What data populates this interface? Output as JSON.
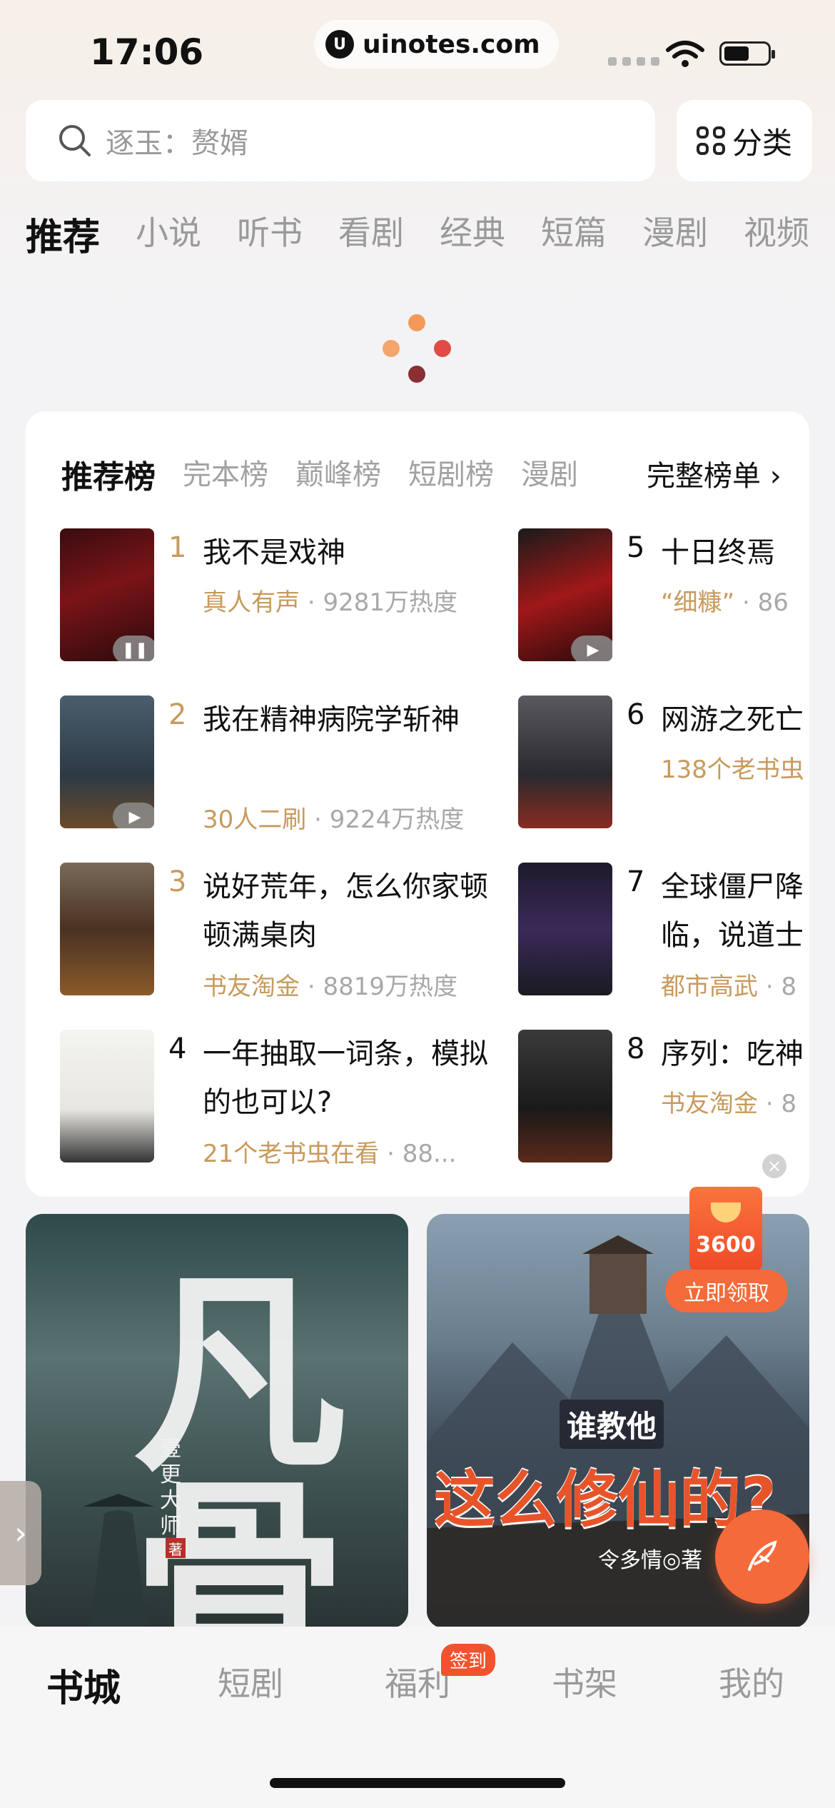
{
  "status_bar": {
    "time": "17:06",
    "url": "uinotes.com"
  },
  "search": {
    "placeholder": "逐玉：赘婿",
    "category_label": "分类"
  },
  "channel_tabs": [
    "推荐",
    "小说",
    "听书",
    "看剧",
    "经典",
    "短篇",
    "漫剧",
    "视频"
  ],
  "ranking": {
    "tabs": [
      "推荐榜",
      "完本榜",
      "巅峰榜",
      "短剧榜",
      "漫剧"
    ],
    "full_list": "完整榜单 ›",
    "left_books": [
      {
        "rank": "1",
        "title": "我不是戏神",
        "tag": "真人有声",
        "heat": "9281万热度"
      },
      {
        "rank": "2",
        "title": "我在精神病院学斩神",
        "tag": "30人二刷",
        "heat": "9224万热度"
      },
      {
        "rank": "3",
        "title": "说好荒年，怎么你家顿顿满桌肉",
        "tag": "书友淘金",
        "heat": "8819万热度"
      },
      {
        "rank": "4",
        "title": "一年抽取一词条，模拟的也可以?",
        "tag": "21个老书虫在看",
        "heat": "88..."
      }
    ],
    "right_books": [
      {
        "rank": "5",
        "title": "十日终焉",
        "tag": "“细糠”",
        "heat": "86"
      },
      {
        "rank": "6",
        "title": "网游之死亡",
        "tag": "138个老书虫",
        "heat": ""
      },
      {
        "rank": "7",
        "title": "全球僵尸降临，说道士序列",
        "tag": "都市高武",
        "heat": "8"
      },
      {
        "rank": "8",
        "title": "序列：吃神",
        "tag": "书友淘金",
        "heat": "8"
      }
    ]
  },
  "banners": [
    {
      "title": "凡骨",
      "author": "壹更大师",
      "author_mark": "著"
    },
    {
      "title": "谁教他这么修仙的?",
      "title_line1": "谁教他",
      "title_line2": "这么修仙的?",
      "author": "令多情◎著"
    }
  ],
  "redpack": {
    "amount": "3600",
    "action": "立即领取"
  },
  "bottom_nav": {
    "items": [
      "书城",
      "短剧",
      "福利",
      "书架",
      "我的"
    ],
    "badge": "签到"
  },
  "colors": {
    "accent_gold": "#c89a5c",
    "accent_orange": "#f46a3a",
    "badge_red": "#f2522e"
  }
}
